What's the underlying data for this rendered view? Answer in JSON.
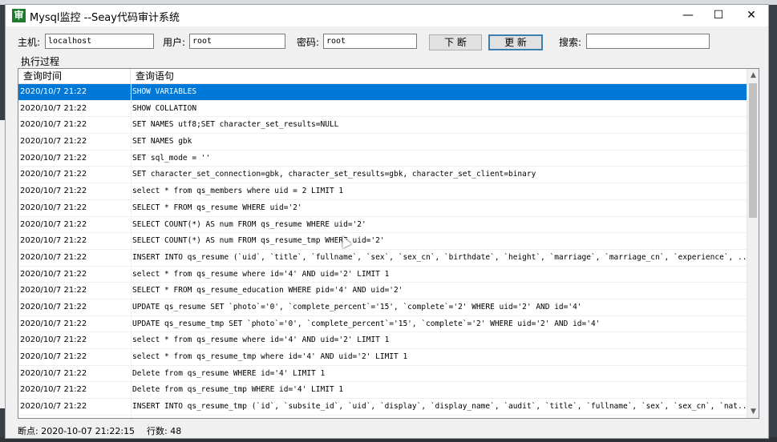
{
  "window": {
    "title": "Mysql监控 --Seay代码审计系统",
    "icon_char": "审"
  },
  "controls": {
    "minimize": "—",
    "maximize": "☐",
    "close": "✕"
  },
  "form": {
    "host_label": "主机:",
    "host_value": "localhost",
    "user_label": "用户:",
    "user_value": "root",
    "pass_label": "密码:",
    "pass_value": "root",
    "stop_button": "下 断",
    "refresh_button": "更 新",
    "search_label": "搜索:",
    "search_value": ""
  },
  "group_label": "执行过程",
  "table": {
    "columns": [
      "查询时间",
      "查询语句"
    ],
    "rows": [
      {
        "time": "2020/10/7 21:22",
        "query": "SHOW VARIABLES"
      },
      {
        "time": "2020/10/7 21:22",
        "query": "SHOW COLLATION"
      },
      {
        "time": "2020/10/7 21:22",
        "query": "SET NAMES utf8;SET character_set_results=NULL"
      },
      {
        "time": "2020/10/7 21:22",
        "query": "SET NAMES gbk"
      },
      {
        "time": "2020/10/7 21:22",
        "query": "SET sql_mode = ''"
      },
      {
        "time": "2020/10/7 21:22",
        "query": "SET character_set_connection=gbk, character_set_results=gbk, character_set_client=binary"
      },
      {
        "time": "2020/10/7 21:22",
        "query": "select * from qs_members where uid = 2 LIMIT 1"
      },
      {
        "time": "2020/10/7 21:22",
        "query": "SELECT * FROM qs_resume WHERE uid='2'"
      },
      {
        "time": "2020/10/7 21:22",
        "query": "SELECT COUNT(*) AS num FROM qs_resume WHERE uid='2'"
      },
      {
        "time": "2020/10/7 21:22",
        "query": "SELECT COUNT(*) AS num FROM qs_resume_tmp WHERE uid='2'"
      },
      {
        "time": "2020/10/7 21:22",
        "query": "INSERT INTO qs_resume (`uid`, `title`, `fullname`, `sex`, `sex_cn`, `birthdate`, `height`, `marriage`, `marriage_cn`, `experience`, ..."
      },
      {
        "time": "2020/10/7 21:22",
        "query": "select * from qs_resume where id='4'  AND uid='2' LIMIT 1"
      },
      {
        "time": "2020/10/7 21:22",
        "query": "SELECT * FROM qs_resume_education WHERE  pid='4' AND uid='2'"
      },
      {
        "time": "2020/10/7 21:22",
        "query": "UPDATE qs_resume SET `photo`='0', `complete_percent`='15', `complete`='2' WHERE uid='2' AND id='4'"
      },
      {
        "time": "2020/10/7 21:22",
        "query": "UPDATE qs_resume_tmp SET `photo`='0', `complete_percent`='15', `complete`='2' WHERE uid='2' AND id='4'"
      },
      {
        "time": "2020/10/7 21:22",
        "query": "select * from qs_resume where id='4' AND uid='2' LIMIT 1"
      },
      {
        "time": "2020/10/7 21:22",
        "query": "select * from qs_resume_tmp where id='4' AND uid='2' LIMIT 1"
      },
      {
        "time": "2020/10/7 21:22",
        "query": "Delete from qs_resume WHERE id='4' LIMIT 1"
      },
      {
        "time": "2020/10/7 21:22",
        "query": "Delete from qs_resume_tmp WHERE id='4' LIMIT 1"
      },
      {
        "time": "2020/10/7 21:22",
        "query": "INSERT INTO qs_resume_tmp (`id`, `subsite_id`, `uid`, `display`, `display_name`, `audit`, `title`, `fullname`, `sex`, `sex_cn`, `nat..."
      }
    ],
    "selected_index": 0
  },
  "status": {
    "breakpoint": "断点: 2020-10-07 21:22:15",
    "row_count": "行数: 48"
  }
}
